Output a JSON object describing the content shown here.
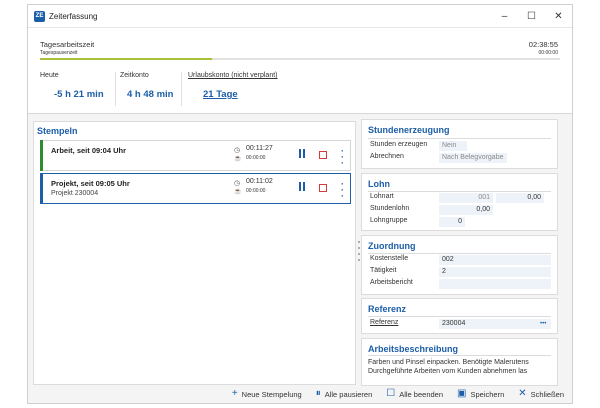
{
  "window": {
    "title": "Zeiterfassung",
    "icon_name": "app-icon",
    "app_icon_letters": "ZE",
    "controls": [
      "minimize-icon",
      "maximize-icon",
      "close-icon"
    ]
  },
  "summary": {
    "tagesarbeitszeit_label": "Tagesarbeitszeit",
    "tagesarbeitszeit_value": "02:38:55",
    "tagespausenzeit_label": "Tagespausenzeit",
    "tagespausenzeit_value": "00:00:00",
    "progress_fraction": 0.33,
    "progress_color": "#a7c23a",
    "heute_label": "Heute",
    "heute_value": "-5 h 21 min",
    "zeitkonto_label": "Zeitkonto",
    "zeitkonto_value": "4 h 48 min",
    "urlaubskonto_label": "Urlaubskonto (nicht verplant)",
    "urlaubskonto_value": "21 Tage"
  },
  "stempeln": {
    "heading": "Stempeln",
    "entries": [
      {
        "title": "Arbeit, seit 09:04 Uhr",
        "subtitle": "",
        "timer": "00:11:27",
        "pause_timer": "00:00:00",
        "bar_color": "#2e8b2e"
      },
      {
        "title": "Projekt, seit 09:05 Uhr",
        "subtitle": "Projekt 230004",
        "timer": "00:11:02",
        "pause_timer": "00:00:00",
        "bar_color": "#1c5ea8"
      }
    ]
  },
  "stundenerzeugung": {
    "heading": "Stundenerzeugung",
    "stunden_label": "Stunden erzeugen",
    "stunden_value": "Nein",
    "abrechnen_label": "Abrechnen",
    "abrechnen_value": "Nach Belegvorgabe"
  },
  "lohn": {
    "heading": "Lohn",
    "lohnart_label": "Lohnart",
    "lohnart_value1": "001",
    "lohnart_value2": "0,00",
    "stundenlohn_label": "Stundenlohn",
    "stundenlohn_value": "0,00",
    "lohngruppe_label": "Lohngruppe",
    "lohngruppe_value": "0"
  },
  "zuordnung": {
    "heading": "Zuordnung",
    "kostenstelle_label": "Kostenstelle",
    "kostenstelle_value": "002",
    "taetigkeit_label": "Tätigkeit",
    "taetigkeit_value": "2",
    "arbeitsbericht_label": "Arbeitsbericht",
    "arbeitsbericht_value": ""
  },
  "referenz": {
    "heading": "Referenz",
    "referenz_label": "Referenz",
    "referenz_value": "230004",
    "more": "•••"
  },
  "arbeitsbeschreibung": {
    "heading": "Arbeitsbeschreibung",
    "line1": "Farben und Pinsel einpacken. Benötigte Malerutens",
    "line2": "Durchgeführte Arbeiten vom Kunden abnehmen las"
  },
  "bottombar": {
    "neue_stempelung": "Neue Stempelung",
    "alle_pausieren": "Alle pausieren",
    "alle_beenden": "Alle beenden",
    "speichern": "Speichern",
    "schliessen": "Schließen"
  }
}
